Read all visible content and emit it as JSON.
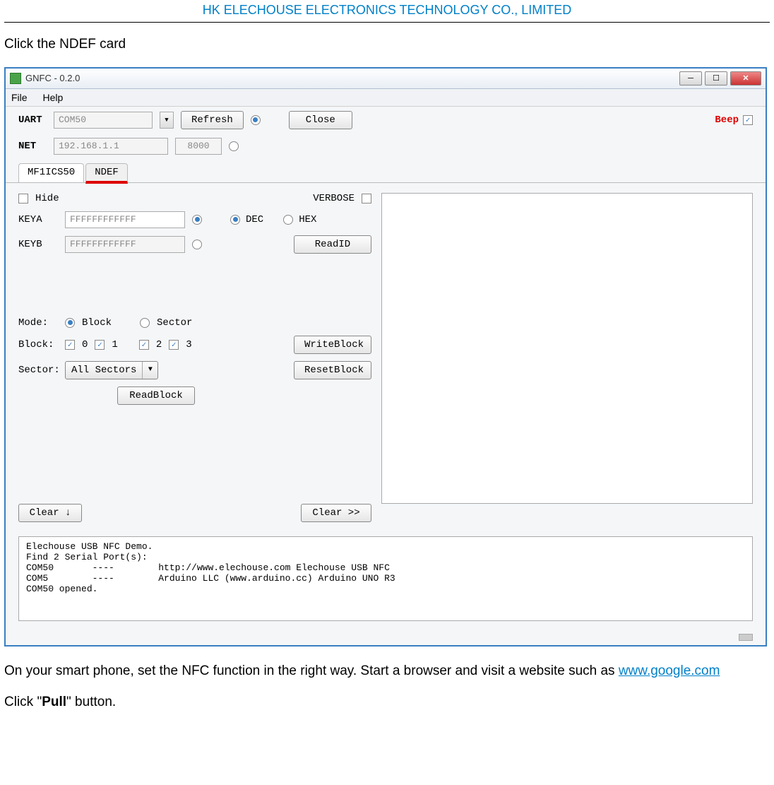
{
  "header": "HK ELECHOUSE ELECTRONICS TECHNOLOGY CO., LIMITED",
  "intro": "Click the NDEF card",
  "window": {
    "title": "GNFC - 0.2.0",
    "menu": {
      "file": "File",
      "help": "Help"
    },
    "uart": {
      "label": "UART",
      "port": "COM50",
      "refresh": "Refresh",
      "close": "Close"
    },
    "net": {
      "label": "NET",
      "ip": "192.168.1.1",
      "port": "8000"
    },
    "beep": "Beep",
    "tabs": {
      "t1": "MF1ICS50",
      "t2": "NDEF"
    },
    "panel": {
      "hide": "Hide",
      "verbose": "VERBOSE",
      "keya": "KEYA",
      "keya_val": "FFFFFFFFFFFF",
      "keyb": "KEYB",
      "keyb_val": "FFFFFFFFFFFF",
      "dec": "DEC",
      "hex": "HEX",
      "readid": "ReadID",
      "mode": "Mode:",
      "block_r": "Block",
      "sector_r": "Sector",
      "block_l": "Block:",
      "b0": "0",
      "b1": "1",
      "b2": "2",
      "b3": "3",
      "sector_l": "Sector:",
      "sector_sel": "All Sectors",
      "readblock": "ReadBlock",
      "writeblock": "WriteBlock",
      "resetblock": "ResetBlock",
      "clear_down": "Clear ↓",
      "clear_right": "Clear >>"
    },
    "log": "Elechouse USB NFC Demo.\nFind 2 Serial Port(s):\nCOM50       ----        http://www.elechouse.com Elechouse USB NFC\nCOM5        ----        Arduino LLC (www.arduino.cc) Arduino UNO R3\nCOM50 opened."
  },
  "outro1a": "On your smart phone, set the NFC function in the right way. Start a browser and visit a website such as ",
  "outro_link": "www.google.com",
  "outro2a": "Click \"",
  "outro2b": "Pull",
  "outro2c": "\" button."
}
